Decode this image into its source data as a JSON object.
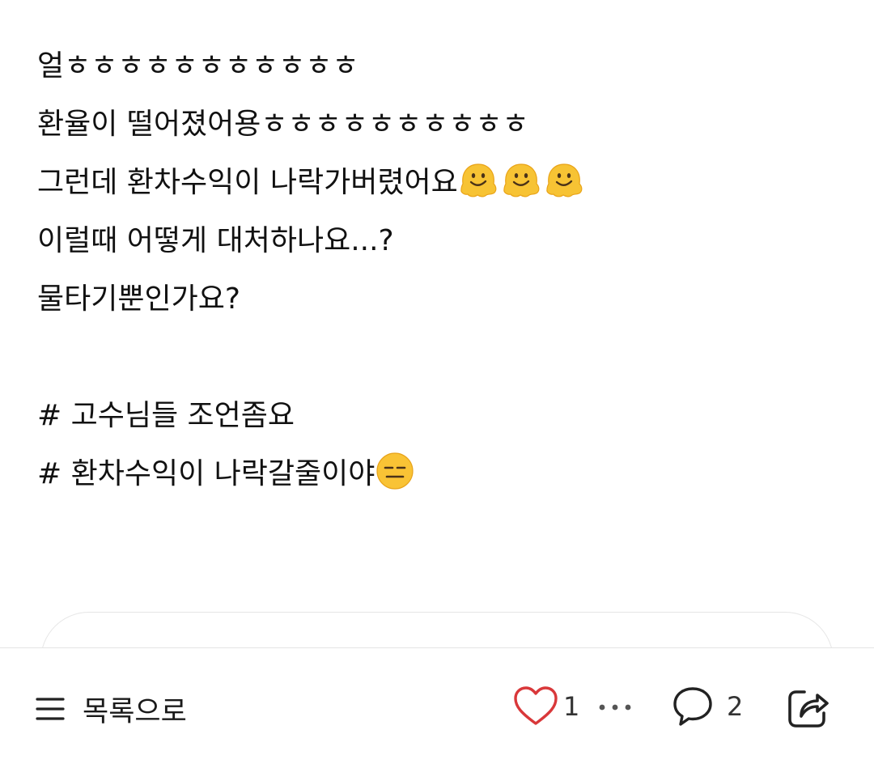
{
  "post": {
    "lines": [
      "얼ㅎㅎㅎㅎㅎㅎㅎㅎㅎㅎㅎ",
      "환율이 떨어졌어용ㅎㅎㅎㅎㅎㅎㅎㅎㅎㅎ",
      "그런데 환차수익이 나락가버렸어요",
      "이럴때 어떻게 대처하나요...?",
      "물타기뿐인가요?"
    ],
    "emojis": {
      "line3": [
        "melting-face",
        "melting-face",
        "melting-face"
      ],
      "hashtag2": [
        "expressionless-face"
      ]
    },
    "hashtags": [
      "# 고수님들 조언좀요",
      "# 환차수익이 나락갈줄이야"
    ]
  },
  "bottom_bar": {
    "list_label": "목록으로",
    "like_count": "1",
    "comment_count": "2",
    "colors": {
      "heart": "#d9383a",
      "icon": "#222222"
    }
  }
}
